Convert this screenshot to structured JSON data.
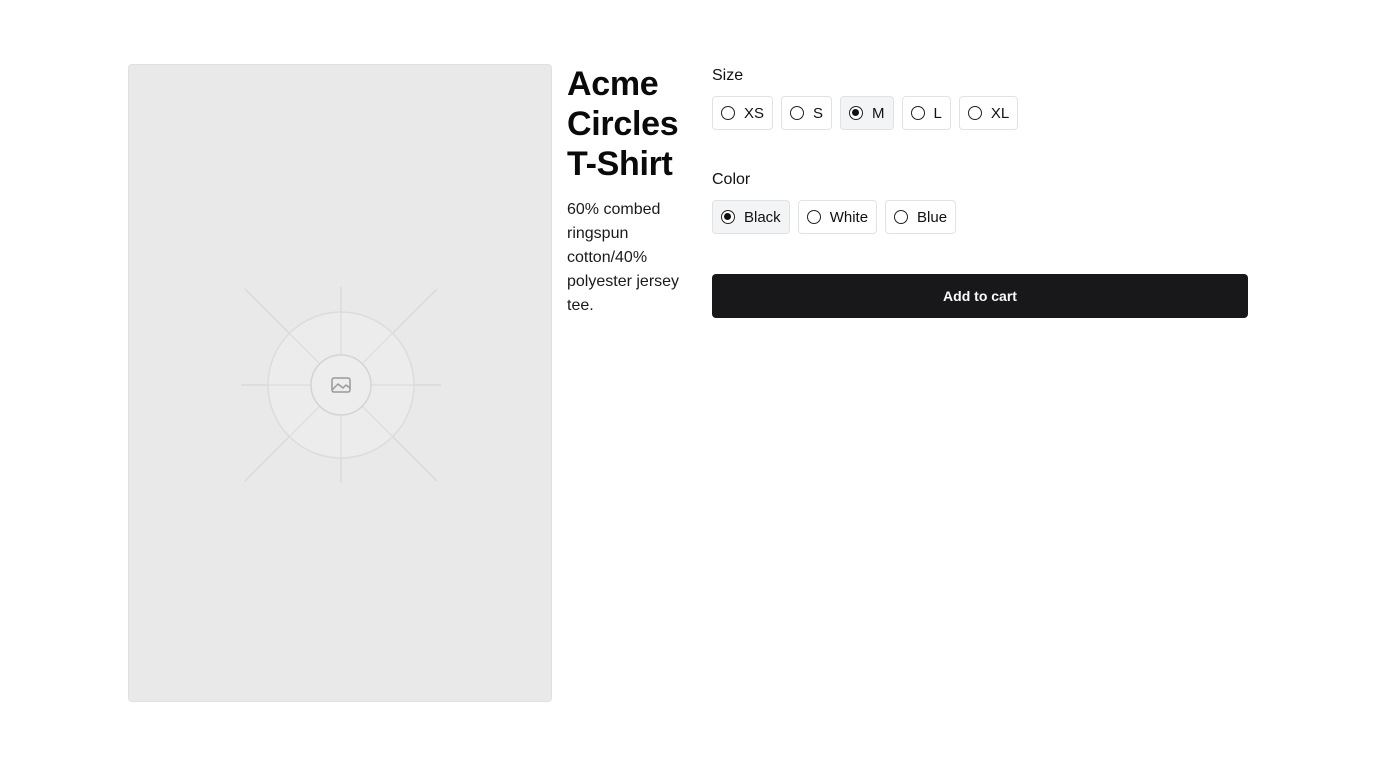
{
  "product": {
    "title": "Acme Circles T-Shirt",
    "description": "60% combed ringspun cotton/40% polyester jersey tee.",
    "image_icon": "image-placeholder-icon"
  },
  "size": {
    "label": "Size",
    "options": [
      {
        "label": "XS",
        "selected": false
      },
      {
        "label": "S",
        "selected": false
      },
      {
        "label": "M",
        "selected": true
      },
      {
        "label": "L",
        "selected": false
      },
      {
        "label": "XL",
        "selected": false
      }
    ]
  },
  "color": {
    "label": "Color",
    "options": [
      {
        "label": "Black",
        "selected": true
      },
      {
        "label": "White",
        "selected": false
      },
      {
        "label": "Blue",
        "selected": false
      }
    ]
  },
  "cart": {
    "button_label": "Add to cart"
  },
  "colors": {
    "button_bg": "#18181b",
    "image_bg": "#e9e9e9",
    "selected_chip_bg": "#f3f4f6"
  }
}
